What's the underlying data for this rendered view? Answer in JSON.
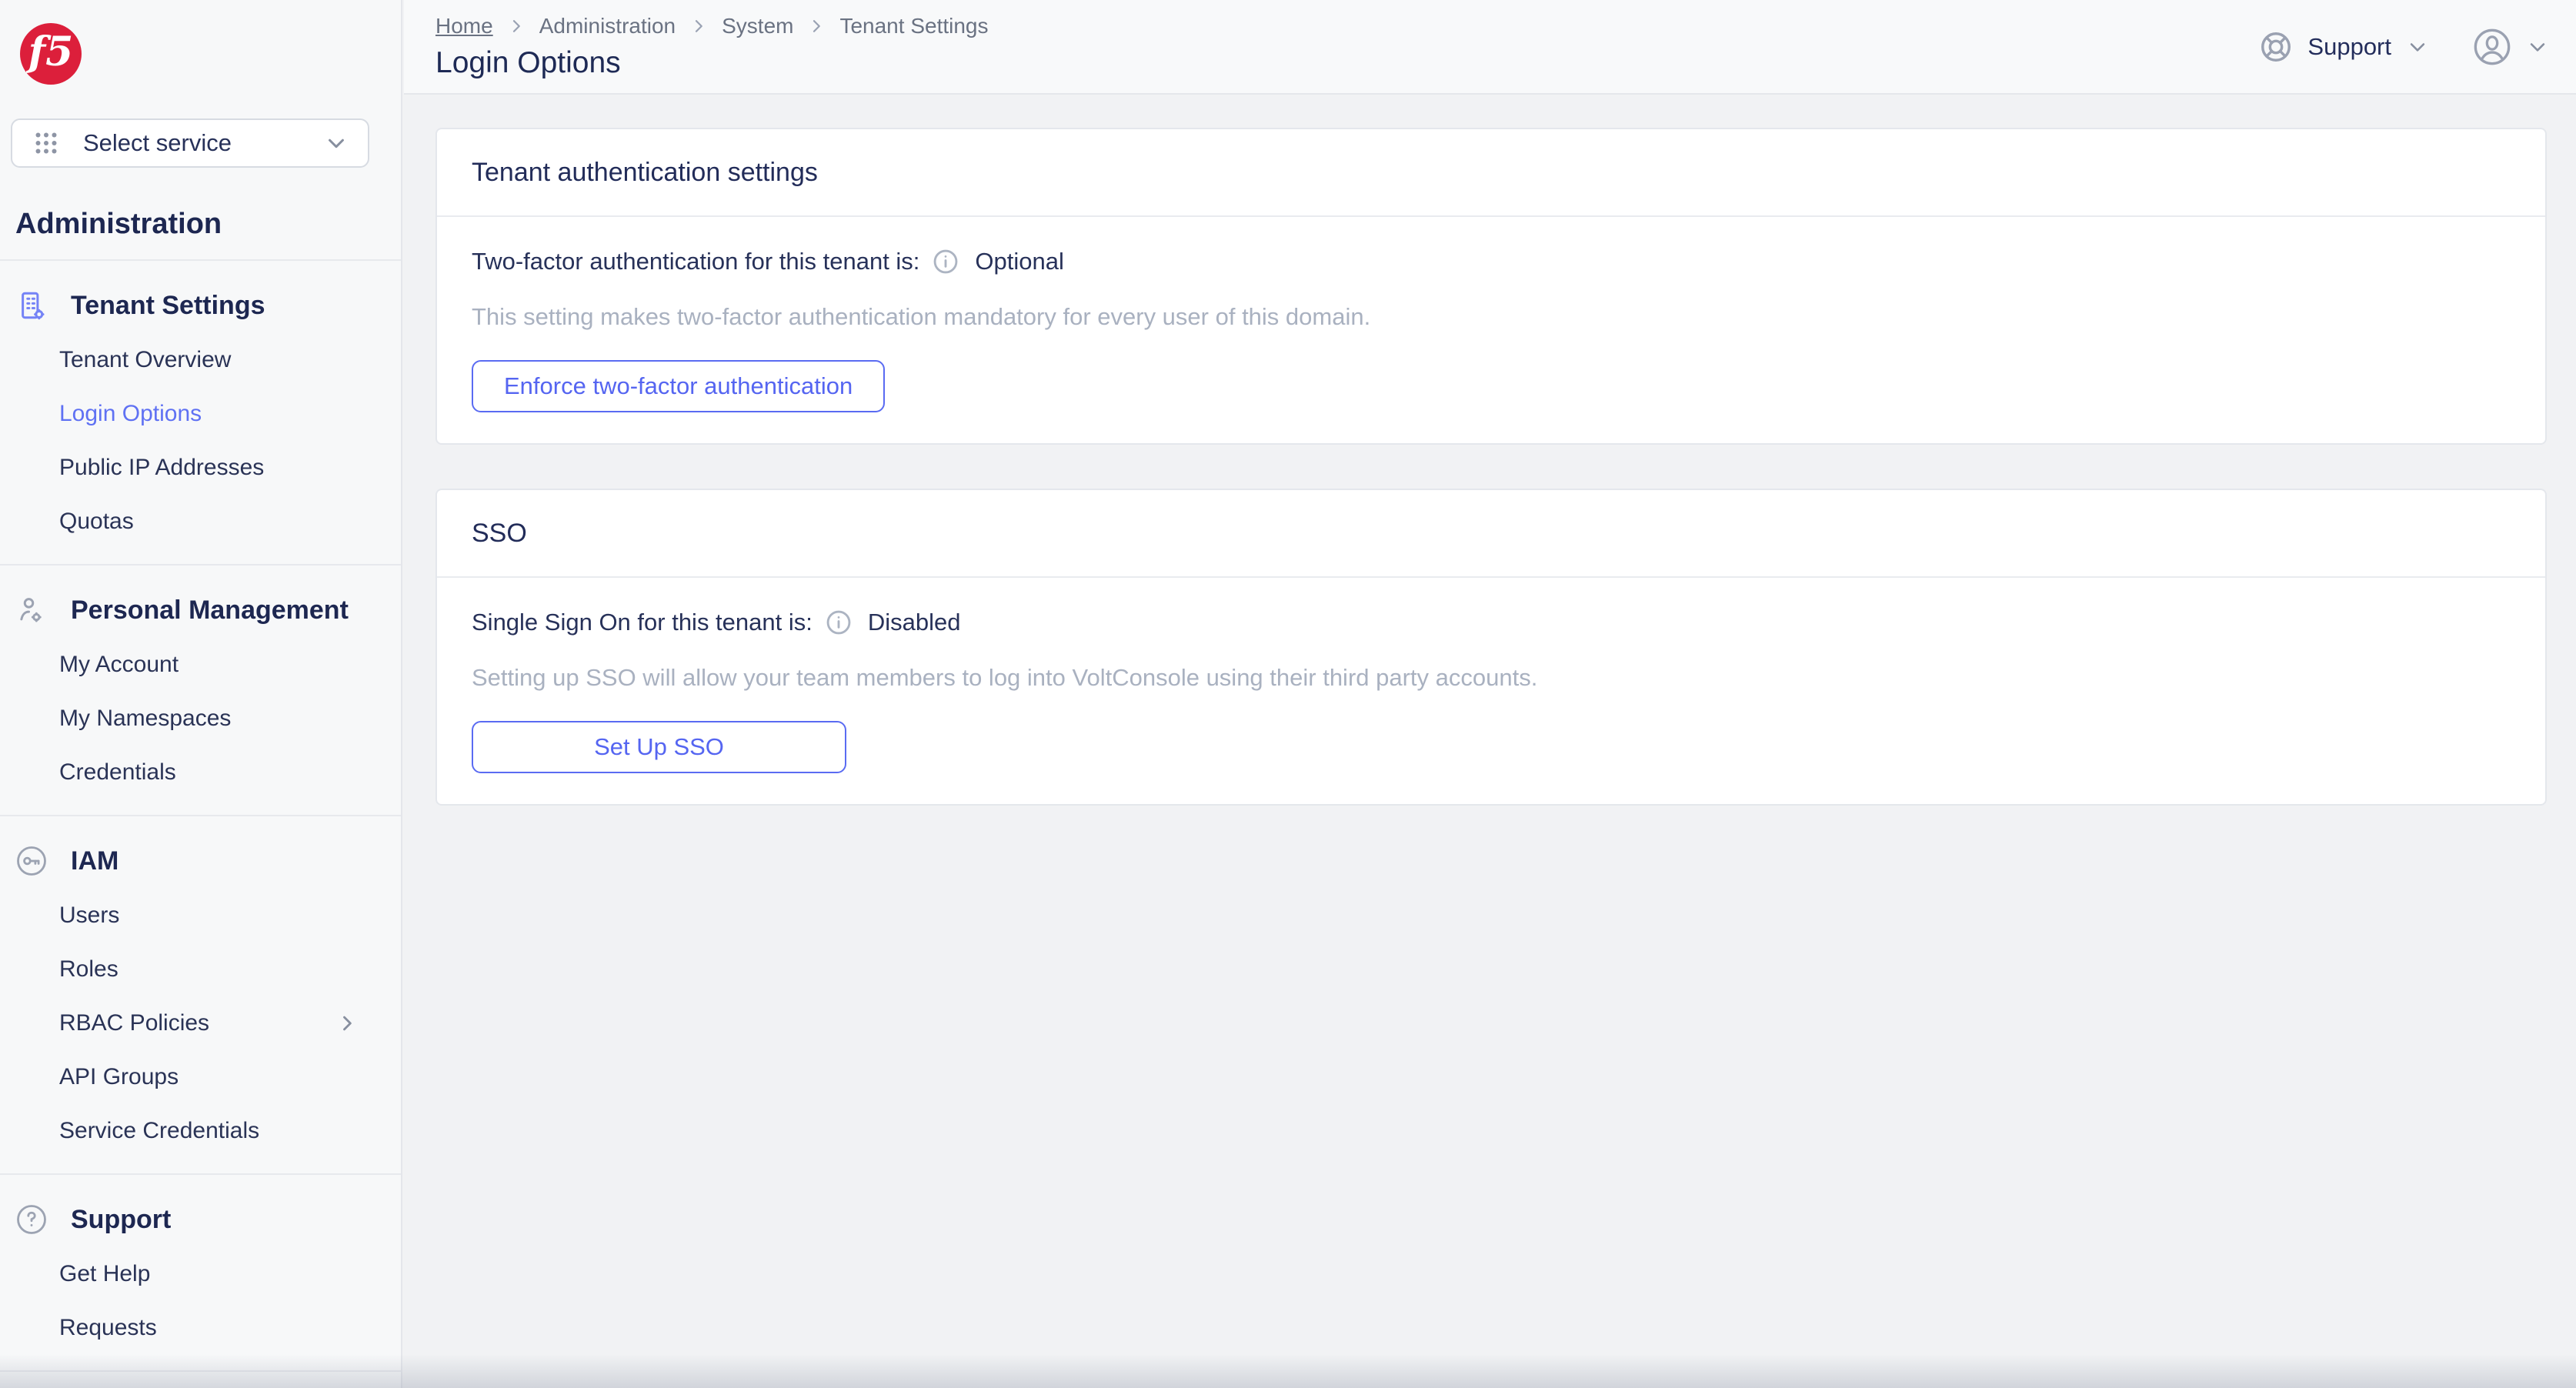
{
  "app": {
    "brand": "f5"
  },
  "colors": {
    "brand_red": "#DC1F3B",
    "accent_indigo": "#5F71F3",
    "text_dark": "#1D2751",
    "text_muted": "#A9B1C0",
    "icon_gray": "#9AA1B1"
  },
  "sidebar": {
    "service_selector": {
      "label": "Select service"
    },
    "product_title": "Administration",
    "sections": [
      {
        "label": "Tenant Settings",
        "icon": "tenant-settings-icon",
        "items": [
          {
            "label": "Tenant Overview"
          },
          {
            "label": "Login Options",
            "active": true
          },
          {
            "label": "Public IP Addresses"
          },
          {
            "label": "Quotas"
          }
        ]
      },
      {
        "label": "Personal Management",
        "icon": "person-gear-icon",
        "items": [
          {
            "label": "My Account"
          },
          {
            "label": "My Namespaces"
          },
          {
            "label": "Credentials"
          }
        ]
      },
      {
        "label": "IAM",
        "icon": "key-icon",
        "items": [
          {
            "label": "Users"
          },
          {
            "label": "Roles"
          },
          {
            "label": "RBAC Policies",
            "has_submenu": true
          },
          {
            "label": "API Groups"
          },
          {
            "label": "Service Credentials"
          }
        ]
      },
      {
        "label": "Support",
        "icon": "help-icon",
        "items": [
          {
            "label": "Get Help"
          },
          {
            "label": "Requests"
          }
        ]
      }
    ]
  },
  "header": {
    "breadcrumbs": [
      "Home",
      "Administration",
      "System",
      "Tenant Settings"
    ],
    "page_title": "Login Options",
    "support_label": "Support"
  },
  "main": {
    "cards": [
      {
        "title": "Tenant authentication settings",
        "status_label": "Two-factor authentication for this tenant is:",
        "status_value": "Optional",
        "description": "This setting makes two-factor authentication mandatory for every user of this domain.",
        "button_label": "Enforce two-factor authentication"
      },
      {
        "title": "SSO",
        "status_label": "Single Sign On for this tenant is:",
        "status_value": "Disabled",
        "description": "Setting up SSO will allow your team members to log into VoltConsole using their third party accounts.",
        "button_label": "Set Up SSO"
      }
    ]
  }
}
